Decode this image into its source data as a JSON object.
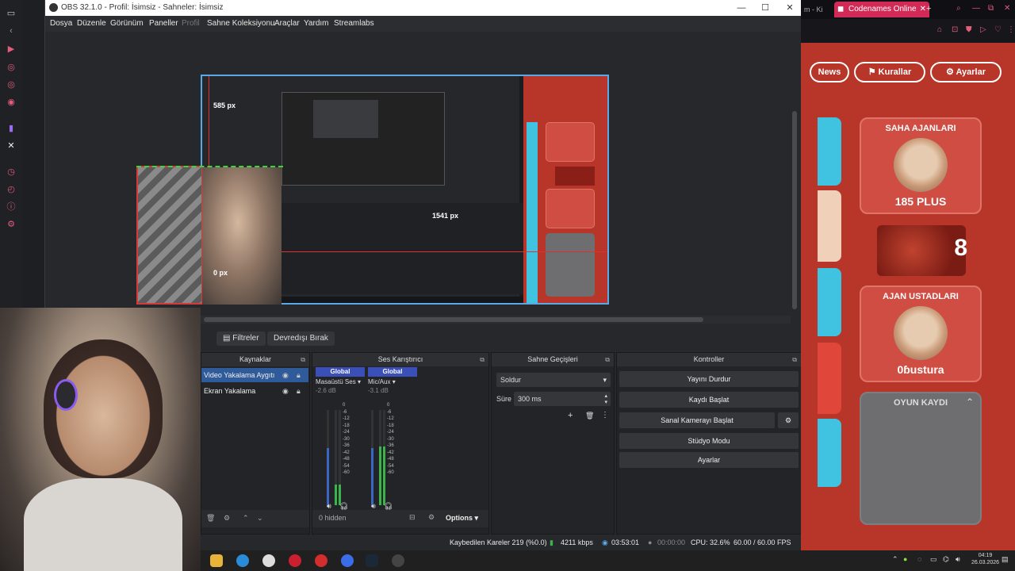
{
  "obs": {
    "title": "OBS 32.1.0 - Profil: İsimsiz - Sahneler: İsimsiz",
    "menu": [
      "Dosya",
      "Düzenle",
      "Görünüm",
      "Paneller",
      "Profil",
      "Sahne Koleksiyonu",
      "Araçlar",
      "Yardım",
      "Streamlabs"
    ],
    "window_buttons": [
      "—",
      "☐",
      "✕"
    ],
    "preview": {
      "label_top": "585 px",
      "label_right": "1541 px",
      "label_bottom": "0 px"
    },
    "toolbar": {
      "filters_label": "Filtreler",
      "deactivate_label": "Devredışı Bırak"
    },
    "sources": {
      "title": "Kaynaklar",
      "items": [
        {
          "label": "Video Yakalama Aygıtı",
          "selected": true
        },
        {
          "label": "Ekran Yakalama",
          "selected": false
        }
      ]
    },
    "mixer": {
      "title": "Ses Karıştırıcı",
      "channels": [
        {
          "head": "Global",
          "name": "Masaüstü Ses",
          "db": "-2.6 dB",
          "level": 0.55
        },
        {
          "head": "Global",
          "name": "Mic/Aux",
          "db": "-3.1 dB",
          "level": 0.6
        }
      ],
      "scale": [
        "0",
        "-6",
        "-12",
        "-18",
        "-24",
        "-30",
        "-36",
        "-42",
        "-48",
        "-54",
        "-60"
      ],
      "footer_hidden": "0 hidden",
      "options_label": "Options"
    },
    "transitions": {
      "title": "Sahne Geçişleri",
      "selected": "Soldur",
      "duration_label": "Süre",
      "duration_value": "300 ms"
    },
    "controls": {
      "title": "Kontroller",
      "buttons": [
        "Yayını Durdur",
        "Kaydı Başlat",
        "Sanal Kamerayı Başlat",
        "Stüdyo Modu",
        "Ayarlar"
      ]
    },
    "status": {
      "dropped": "Kaybedilen Kareler 219 (%0.0)",
      "bitrate": "4211 kbps",
      "stream_time": "03:53:01",
      "rec_time": "00:00:00",
      "cpu": "CPU: 32.6%",
      "fps": "60.00 / 60.00 FPS"
    }
  },
  "browser": {
    "tab_prefix": "m - Ki",
    "tab_title": "Codenames Online",
    "new_tab": "+",
    "pills": [
      "News",
      "Kurallar",
      "Ayarlar"
    ],
    "cards": [
      {
        "title": "SAHA AJANLARI",
        "value": "185 PLUS"
      },
      {
        "title": "",
        "value": "8"
      },
      {
        "title": "AJAN USTADLARI",
        "value": "0ɓustura"
      },
      {
        "title": "OYUN KAYDI",
        "value": ""
      }
    ]
  },
  "taskbar": {
    "time": "04:19",
    "date": "26.03.2026"
  },
  "colors": {
    "selection_blue": "#2f5b9a",
    "mixer_head": "#3b4fb8",
    "codenames_red": "#b73529",
    "preview_border": "#5aa9e6"
  }
}
